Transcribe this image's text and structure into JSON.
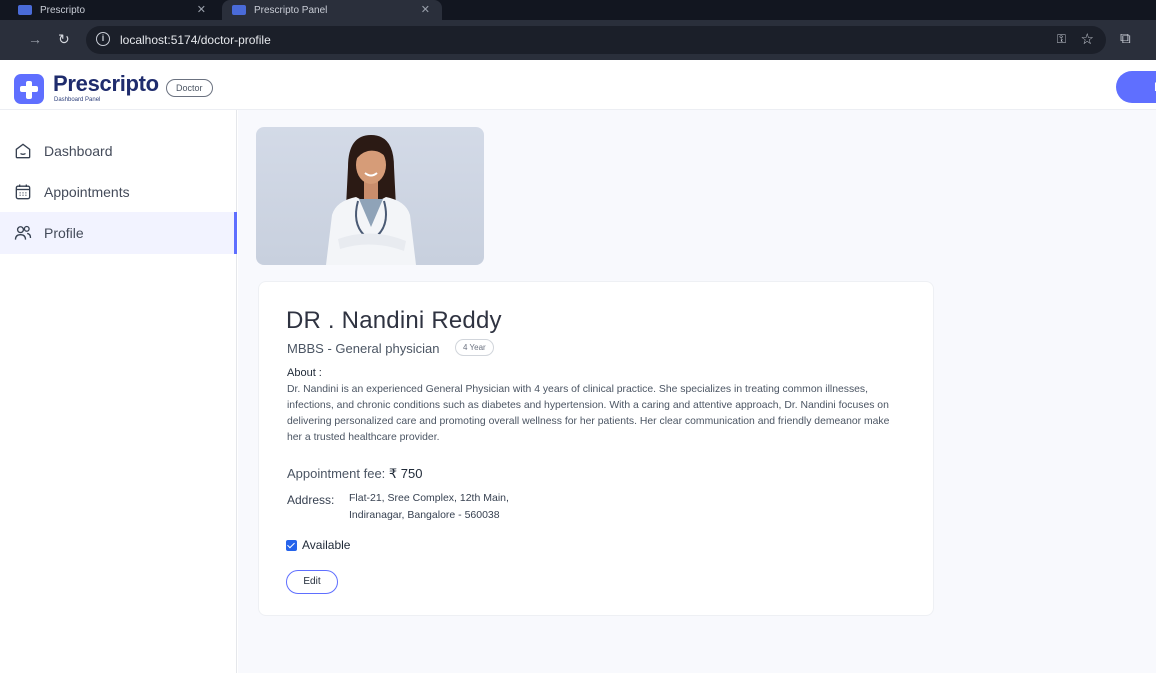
{
  "browser": {
    "tabs": [
      {
        "title": "Prescripto"
      },
      {
        "title": "Prescripto Panel"
      }
    ],
    "url": "localhost:5174/doctor-profile"
  },
  "header": {
    "brand": "Prescripto",
    "brand_subtitle": "Dashboard Panel",
    "role_badge": "Doctor",
    "logout_label": "Logout"
  },
  "sidebar": {
    "items": [
      {
        "label": "Dashboard",
        "icon": "home-icon",
        "active": false
      },
      {
        "label": "Appointments",
        "icon": "calendar-icon",
        "active": false
      },
      {
        "label": "Profile",
        "icon": "people-icon",
        "active": true
      }
    ]
  },
  "profile": {
    "name": "DR . Nandini Reddy",
    "degree": "MBBS - General physician",
    "experience": "4 Year",
    "about_label": "About :",
    "about_text": "Dr. Nandini is an experienced General Physician with 4 years of clinical practice. She specializes in treating common illnesses, infections, and chronic conditions such as diabetes and hypertension. With a caring and attentive approach, Dr. Nandini focuses on delivering personalized care and promoting overall wellness for her patients. Her clear communication and friendly demeanor make her a trusted healthcare provider.",
    "fee_label": "Appointment fee:",
    "fee_value": "₹ 750",
    "address_label": "Address:",
    "address_line1": "Flat-21, Sree Complex, 12th Main,",
    "address_line2": "Indiranagar, Bangalore - 560038",
    "available_label": "Available",
    "available": true,
    "edit_label": "Edit"
  },
  "colors": {
    "accent": "#5f6fff",
    "brand_text": "#1f2c6d",
    "main_bg": "#f8f9fd"
  }
}
